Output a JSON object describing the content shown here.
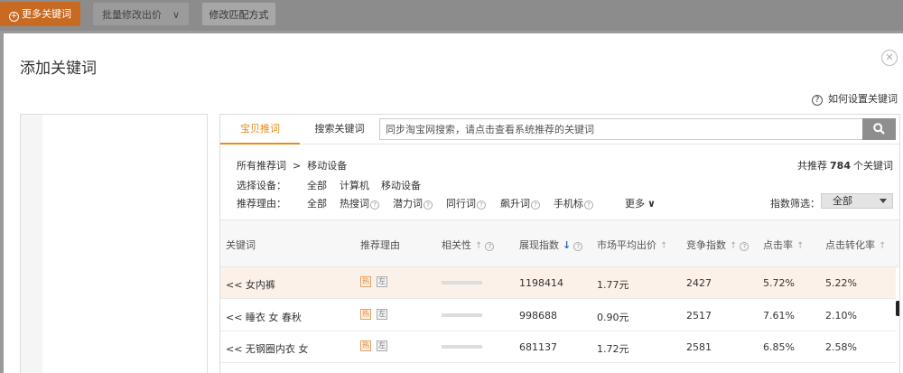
{
  "toolbar": {
    "more_keywords": "更多关键词",
    "batch_modify_bid": "批量修改出价",
    "modify_match": "修改匹配方式"
  },
  "dialog": {
    "title": "添加关键词",
    "help_text": "如何设置关键词"
  },
  "tabs": [
    {
      "label": "宝贝推词"
    },
    {
      "label": "搜索关键词"
    }
  ],
  "search": {
    "placeholder": "同步淘宝网搜索，请点击查看系统推荐的关键词"
  },
  "breadcrumb": {
    "root": "所有推荐词",
    "separator": ">",
    "current": "移动设备"
  },
  "total": {
    "prefix": "共推荐",
    "count": "784",
    "suffix": "个关键词"
  },
  "device": {
    "label": "选择设备：",
    "options": [
      "全部",
      "计算机",
      "移动设备"
    ]
  },
  "reason": {
    "label": "推荐理由：",
    "options": [
      "全部",
      "热搜词",
      "潜力词",
      "同行词",
      "飙升词",
      "手机标"
    ]
  },
  "more": "更多",
  "index_filter": {
    "label": "指数筛选：",
    "value": "全部"
  },
  "table": {
    "headers": [
      "关键词",
      "推荐理由",
      "相关性",
      "展现指数",
      "市场平均出价",
      "竞争指数",
      "点击率",
      "点击转化率"
    ],
    "rows": [
      {
        "keyword": "<< 女内裤",
        "reason_hot": "热",
        "reason_left": "左",
        "relevance": 0.8,
        "impressions": "1198414",
        "avg_bid": "1.77元",
        "competition": "2427",
        "ctr": "5.72%",
        "cvr": "5.22%"
      },
      {
        "keyword": "<< 睡衣 女 春秋",
        "reason_hot": "热",
        "reason_left": "左",
        "relevance": 0.8,
        "impressions": "998688",
        "avg_bid": "0.90元",
        "competition": "2517",
        "ctr": "7.61%",
        "cvr": "2.10%"
      },
      {
        "keyword": "<< 无钢圈内衣 女",
        "reason_hot": "热",
        "reason_left": "左",
        "relevance": 0.8,
        "impressions": "681137",
        "avg_bid": "1.72元",
        "competition": "2581",
        "ctr": "6.85%",
        "cvr": "2.58%"
      }
    ]
  },
  "colors": {
    "accent": "#e98b1a",
    "primary_button": "#c96a22",
    "highlight_row": "#fbf1e9",
    "sort_arrow": "#2a66b8"
  },
  "icons": {
    "close": "close-icon",
    "help": "help-icon",
    "search": "search-icon",
    "sort_up": "sort-up-icon",
    "sort_down": "sort-down-icon",
    "chevron": "chevron-down-icon"
  }
}
